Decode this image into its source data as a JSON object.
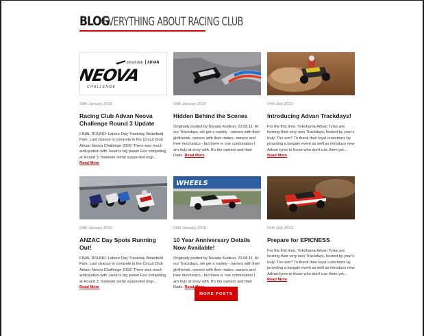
{
  "header": {
    "title_strong": "BLOG",
    "title_light": "EVERYTHING ABOUT RACING CLUB"
  },
  "logo": {
    "brand_left": "circuit club",
    "brand_right": "ADVAN",
    "wordmark": "NEOVA",
    "sub": "C H A L L E N G E"
  },
  "posts": [
    {
      "date": "09th January 2016",
      "title": "Racing Club Advan Neova Challenge Round 3 Update",
      "excerpt": "FINAL ROUND: Labour Day Trackday Wakefield Park. Last chance to compete in the Circuit Club Advan Neova Challenge 2016! There was much anticipation with Jason's big power Evo competing at Round 3, however some suspected engi...",
      "read_more": "Read More"
    },
    {
      "date": "09th January 2016",
      "title": "Hidden Behind the Scenes",
      "excerpt": "Originally posted by Narada Kudinar, 23.08.11. At our Trackdays, we get a variety - owners with their girlfriends, owners with their mates, owners and their mechanics - but there is one combination I am truly at envy with. It's the owners and their Dads.",
      "read_more": "Read More"
    },
    {
      "date": "04th July 2013",
      "title": "Introducing Advan Trackdays!",
      "excerpt": "For the first time, Yokohama Advan Tyres are hosting their very own Trackdays, hosted by your's truly! The aim? To thank their loyal customers by providing a bargain event as well as introduce new Advan tyres to those who don't use them yet...",
      "read_more": "Read More"
    },
    {
      "date": "09th January 2016",
      "title": "ANZAC Day Spots Running Out!",
      "excerpt": "FINAL ROUND: Labour Day Trackday Wakefield Park. Last chance to compete in the Circuit Club Advan Neova Challenge 2016! There was much anticipation with Jason's big power Evo competing at Round 3, however some suspected engi...",
      "read_more": "Read More"
    },
    {
      "date": "09th January 2016",
      "title": "10 Year Anniversary Details Now Available!",
      "excerpt": "Originally posted by Narada Kudinar, 23.08.11. At our Trackdays, we get a variety - owners with their girlfriends, owners with their mates, owners and their mechanics - but there is one combination I am truly at envy with. It's the owners and their Dads.",
      "read_more": "Read More",
      "thumb_text": "WHEELS"
    },
    {
      "date": "04th July 2013",
      "title": "Prepare for EPICNESS",
      "excerpt": "For the first time, Yokohama Advan Tyres are hosting their very own Trackdays, hosted by your's truly! The aim? To thank their loyal customers by providing a bargain event as well as introduce new Advan tyres to those who don't use them yet...",
      "read_more": "Read More"
    }
  ],
  "more_button": "MORE POSTS",
  "colors": {
    "accent": "#d40000",
    "title": "#1a1a1a",
    "date": "#8a8a8a"
  }
}
